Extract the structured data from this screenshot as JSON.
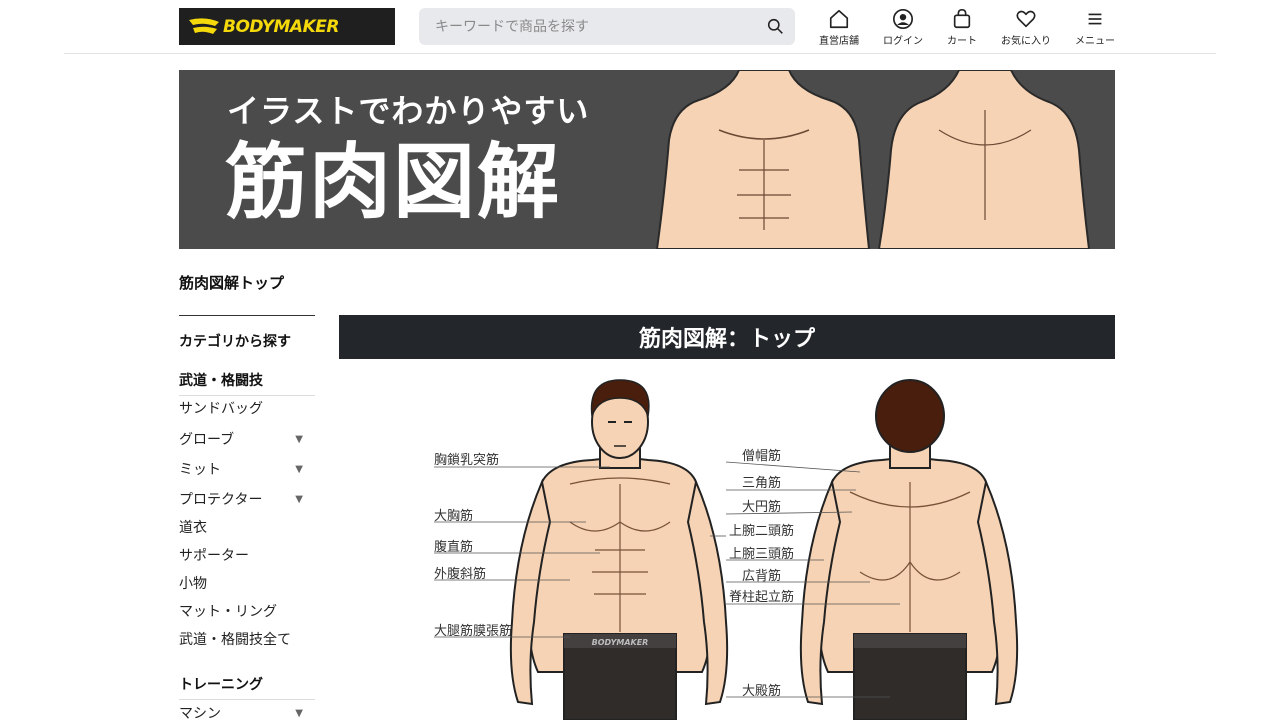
{
  "header": {
    "logo_text": "BODYMAKER",
    "search_placeholder": "キーワードで商品を探す",
    "nav": {
      "store": "直営店舗",
      "login": "ログイン",
      "cart": "カート",
      "favorites": "お気に入り",
      "menu": "メニュー"
    }
  },
  "banner": {
    "subtitle": "イラストでわかりやすい",
    "title": "筋肉図解"
  },
  "sidebar": {
    "top_link": "筋肉図解トップ",
    "category_heading": "カテゴリから探す",
    "groups": [
      {
        "title": "武道・格闘技",
        "items": [
          {
            "label": "サンドバッグ",
            "arrow": ""
          },
          {
            "label": "グローブ",
            "arrow": "▼"
          },
          {
            "label": "ミット",
            "arrow": "▼"
          },
          {
            "label": "プロテクター",
            "arrow": "▼"
          },
          {
            "label": "道衣",
            "arrow": ""
          },
          {
            "label": "サポーター",
            "arrow": ""
          },
          {
            "label": "小物",
            "arrow": ""
          },
          {
            "label": "マット・リング",
            "arrow": ""
          },
          {
            "label": "武道・格闘技全て",
            "arrow": ""
          }
        ]
      },
      {
        "title": "トレーニング",
        "items": [
          {
            "label": "マシン",
            "arrow": "▼"
          }
        ]
      }
    ]
  },
  "main": {
    "heading": "筋肉図解：トップ"
  },
  "diagram": {
    "front_labels": [
      "胸鎖乳突筋",
      "大胸筋",
      "腹直筋",
      "外腹斜筋",
      "大腿筋膜張筋"
    ],
    "back_labels": [
      "僧帽筋",
      "三角筋",
      "大円筋",
      "上腕二頭筋",
      "上腕三頭筋",
      "広背筋",
      "脊柱起立筋",
      "大殿筋"
    ],
    "waistband_text": "BODYMAKER"
  },
  "colors": {
    "logo_bg": "#1f1f1f",
    "logo_accent": "#f5d90a",
    "banner_bg": "#4b4b4b",
    "heading_bg": "#23262b",
    "skin": "#f6d3b4"
  }
}
